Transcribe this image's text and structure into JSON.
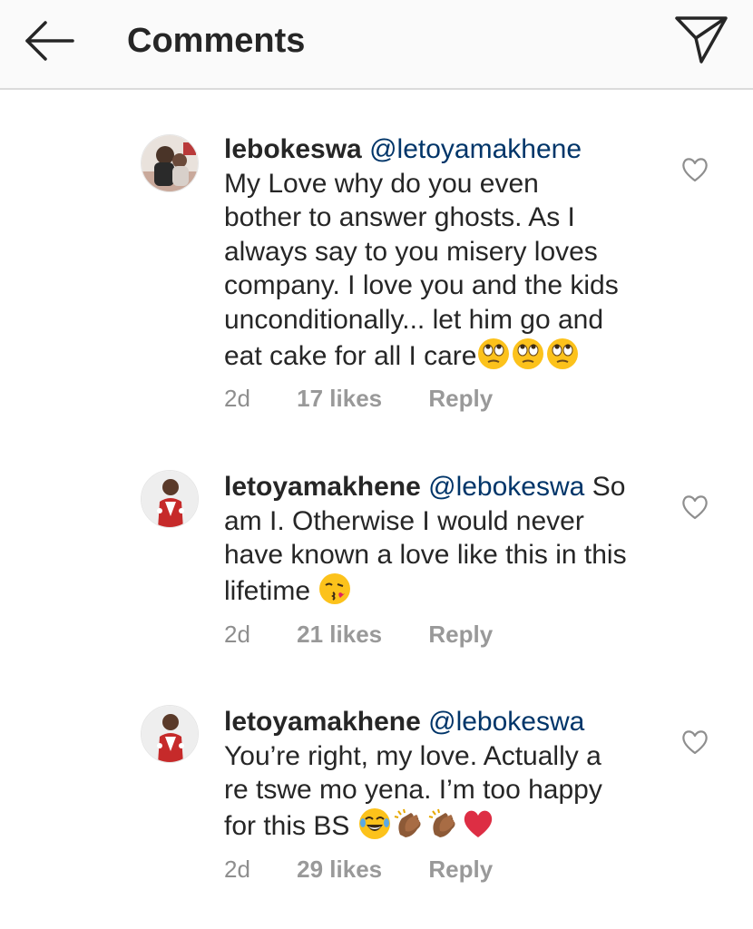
{
  "header": {
    "title": "Comments",
    "back_icon": "arrow-left-icon",
    "share_icon": "paper-plane-icon"
  },
  "comments": [
    {
      "username": "lebokeswa",
      "mention": "@letoyamakhene",
      "text_lines": [
        "My Love why do you even",
        "bother to answer ghosts. As I",
        "always say to you misery loves",
        "company. I love you and the kids",
        "unconditionally... let him go and",
        "eat cake for all I care"
      ],
      "emojis": [
        "face-with-rolling-eyes",
        "face-with-rolling-eyes",
        "face-with-rolling-eyes"
      ],
      "time": "2d",
      "likes": "17 likes",
      "reply": "Reply"
    },
    {
      "username": "letoyamakhene",
      "mention": "@lebokeswa",
      "text_lines": [
        "So",
        "am I. Otherwise I would never",
        "have known a love like this in this",
        "lifetime"
      ],
      "emojis": [
        "face-blowing-a-kiss"
      ],
      "time": "2d",
      "likes": "21 likes",
      "reply": "Reply"
    },
    {
      "username": "letoyamakhene",
      "mention": "@lebokeswa",
      "text_lines": [
        "You’re right, my love. Actually a",
        "re tswe mo yena. I’m too happy",
        "for this BS"
      ],
      "emojis": [
        "face-with-tears-of-joy",
        "clapping-hands",
        "clapping-hands",
        "red-heart"
      ],
      "time": "2d",
      "likes": "29 likes",
      "reply": "Reply"
    }
  ],
  "colors": {
    "header_bg": "#fafafa",
    "text": "#262626",
    "mention": "#003569",
    "meta": "#8e8e8e",
    "heart_outline": "#8e8e8e"
  }
}
